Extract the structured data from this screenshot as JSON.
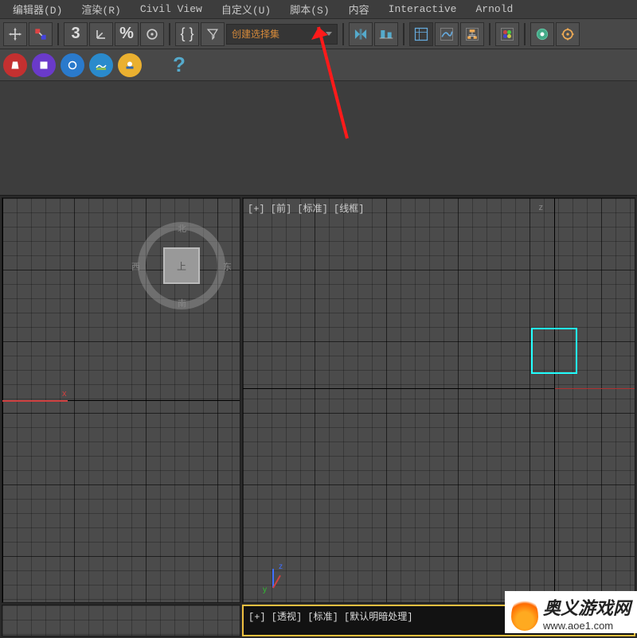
{
  "menu": {
    "editor": "编辑器(D)",
    "render": "渲染(R)",
    "civil": "Civil View",
    "customize": "自定义(U)",
    "script": "脚本(S)",
    "content": "内容",
    "interactive": "Interactive",
    "arnold": "Arnold"
  },
  "toolbar": {
    "selection_set_label": "创建选择集"
  },
  "viewports": {
    "top": {
      "cube_face": "上",
      "dir_n": "北",
      "dir_s": "南",
      "dir_e": "东",
      "dir_w": "西",
      "axis_x": "x"
    },
    "front": {
      "label": "[+] [前] [标准] [线框]",
      "axis_z": "z",
      "axis_y": "y"
    },
    "perspective": {
      "label": "[+] [透视] [标准] [默认明暗处理]"
    },
    "front_z_marker": "z"
  },
  "watermark": {
    "title": "奥义游戏网",
    "url": "www.aoe1.com"
  }
}
